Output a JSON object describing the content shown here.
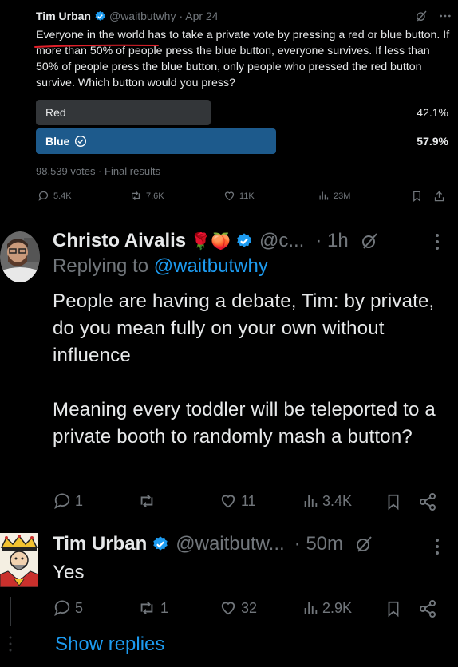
{
  "quoted": {
    "name": "Tim Urban",
    "handle": "@waitbutwhy",
    "date": "· Apr 24",
    "text": "Everyone in the world has to take a private vote by pressing a red or blue button. If more than 50% of people press the blue button, everyone survives. If less than 50% of people press the blue button, only people who pressed the red button survive. Which button would you press?",
    "poll": [
      {
        "label": "Red",
        "pct": "42.1%",
        "percent": 42.1
      },
      {
        "label": "Blue",
        "pct": "57.9%",
        "percent": 57.9,
        "selected": true
      }
    ],
    "meta": "98,539 votes · Final results",
    "actions": {
      "replies": "5.4K",
      "reposts": "7.6K",
      "likes": "11K",
      "views": "23M"
    }
  },
  "reply1": {
    "name": "Christo Aivalis",
    "emoji": "🌹🍑",
    "handle": "@c...",
    "time": "· 1h",
    "replying_prefix": "Replying to",
    "replying_handle": "@waitbutwhy",
    "text": "People are having a debate, Tim: by private, do you mean fully on your own without influence\n\nMeaning every toddler will be teleported to a private booth to randomly mash a button?",
    "actions": {
      "replies": "1",
      "reposts": "",
      "likes": "11",
      "views": "3.4K"
    }
  },
  "reply2": {
    "name": "Tim Urban",
    "handle": "@waitbutw...",
    "time": "· 50m",
    "text": "Yes",
    "actions": {
      "replies": "5",
      "reposts": "1",
      "likes": "32",
      "views": "2.9K"
    }
  },
  "show_replies": "Show replies",
  "colors": {
    "verified": "#1d9bf0",
    "poll_blue": "#1d5a8c",
    "poll_grey": "#333639",
    "annotation_red": "#e0202a"
  }
}
